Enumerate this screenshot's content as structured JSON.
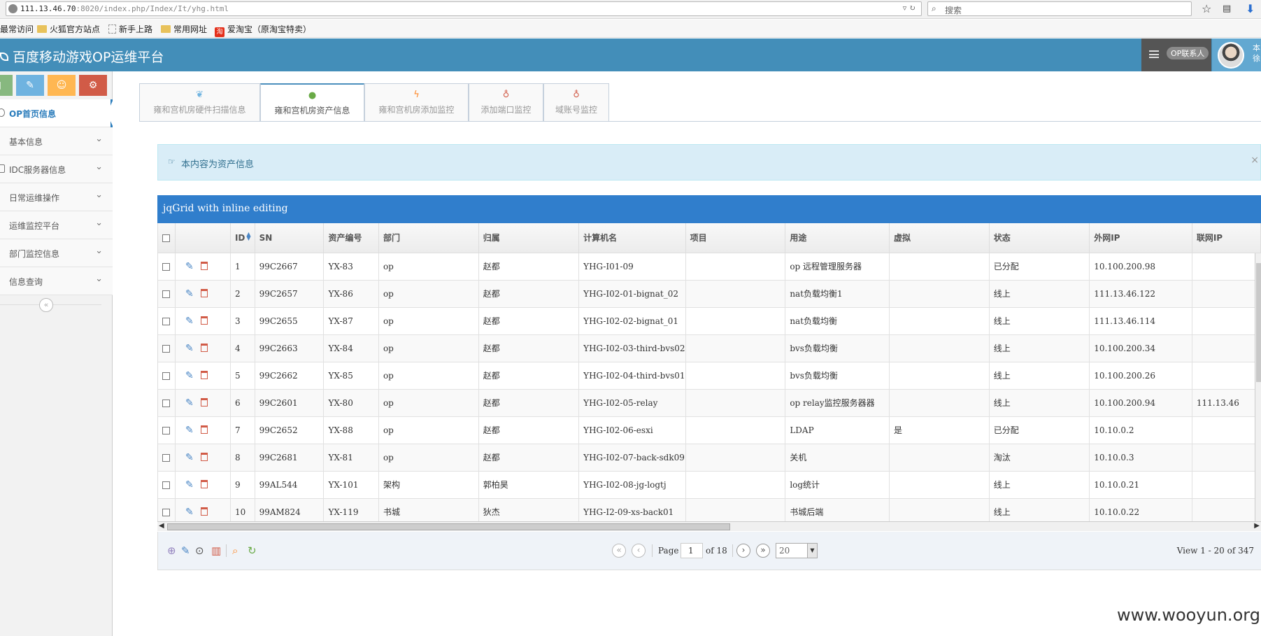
{
  "browser": {
    "url_host": "111.13.46.70",
    "url_rest": ":8020/index.php/Index/It/yhg.html",
    "search_placeholder": "搜索"
  },
  "bookmarks": [
    "最常访问",
    "火狐官方站点",
    "新手上路",
    "常用网址",
    "爱淘宝（原淘宝特卖）"
  ],
  "header": {
    "title": "百度移动游戏OP运维平台",
    "contact_badge": "OP联系人",
    "user_name": "本 徐"
  },
  "sidebar": {
    "shortcut_colors": [
      "#87b87f",
      "#6fb3e0",
      "#ffb752",
      "#d15b47"
    ],
    "shortcut_icons": [
      "chart-icon",
      "pencil-icon",
      "users-icon",
      "cogs-icon"
    ],
    "items": [
      {
        "label": "OP首页信息",
        "active": true
      },
      {
        "label": "基本信息"
      },
      {
        "label": "IDC服务器信息"
      },
      {
        "label": "日常运维操作"
      },
      {
        "label": "运维监控平台"
      },
      {
        "label": "部门监控信息"
      },
      {
        "label": "信息查询"
      }
    ]
  },
  "tabs": [
    {
      "label": "雍和宫机房硬件扫描信息",
      "icon": "leaf-icon",
      "color": "#6fb3e0"
    },
    {
      "label": "雍和宫机房资产信息",
      "icon": "user-icon",
      "color": "#69aa46",
      "active": true
    },
    {
      "label": "雍和宫机房添加监控",
      "icon": "bolt-icon",
      "color": "#ff892a"
    },
    {
      "label": "添加端口监控",
      "icon": "bulb-icon",
      "color": "#d15b47"
    },
    {
      "label": "域账号监控",
      "icon": "bulb-icon",
      "color": "#d15b47"
    }
  ],
  "alert": {
    "text": "本内容为资产信息",
    "close": "×"
  },
  "grid": {
    "caption": "jqGrid with inline editing",
    "columns": [
      "ID",
      "SN",
      "资产编号",
      "部门",
      "归属",
      "计算机名",
      "项目",
      "用途",
      "虚拟",
      "状态",
      "外网IP",
      "联网IP"
    ],
    "rows": [
      [
        "1",
        "99C2667",
        "YX-83",
        "op",
        "赵都",
        "YHG-I01-09",
        "",
        "op 远程管理服务器",
        "",
        "已分配",
        "10.100.200.98",
        ""
      ],
      [
        "2",
        "99C2657",
        "YX-86",
        "op",
        "赵都",
        "YHG-I02-01-bignat_02",
        "",
        "nat负载均衡1",
        "",
        "线上",
        "111.13.46.122",
        ""
      ],
      [
        "3",
        "99C2655",
        "YX-87",
        "op",
        "赵都",
        "YHG-I02-02-bignat_01",
        "",
        "nat负载均衡",
        "",
        "线上",
        "111.13.46.114",
        ""
      ],
      [
        "4",
        "99C2663",
        "YX-84",
        "op",
        "赵都",
        "YHG-I02-03-third-bvs02",
        "",
        "bvs负载均衡",
        "",
        "线上",
        "10.100.200.34",
        ""
      ],
      [
        "5",
        "99C2662",
        "YX-85",
        "op",
        "赵都",
        "YHG-I02-04-third-bvs01",
        "",
        "bvs负载均衡",
        "",
        "线上",
        "10.100.200.26",
        ""
      ],
      [
        "6",
        "99C2601",
        "YX-80",
        "op",
        "赵都",
        "YHG-I02-05-relay",
        "",
        "op relay监控服务器器",
        "",
        "线上",
        "10.100.200.94",
        "111.13.46"
      ],
      [
        "7",
        "99C2652",
        "YX-88",
        "op",
        "赵都",
        "YHG-I02-06-esxi",
        "",
        "LDAP",
        "是",
        "已分配",
        "10.10.0.2",
        ""
      ],
      [
        "8",
        "99C2681",
        "YX-81",
        "op",
        "赵都",
        "YHG-I02-07-back-sdk09",
        "",
        "关机",
        "",
        "淘汰",
        "10.10.0.3",
        ""
      ],
      [
        "9",
        "99AL544",
        "YX-101",
        "架构",
        "郭柏昊",
        "YHG-I02-08-jg-logtj",
        "",
        "log统计",
        "",
        "线上",
        "10.10.0.21",
        ""
      ],
      [
        "10",
        "99AM824",
        "YX-119",
        "书城",
        "狄杰",
        "YHG-I2-09-xs-back01",
        "",
        "书城后端",
        "",
        "线上",
        "10.10.0.22",
        ""
      ]
    ]
  },
  "pager": {
    "page_label": "Page",
    "page_value": "1",
    "of_label": "of 18",
    "page_size": "20",
    "view_text": "View 1 - 20 of 347"
  },
  "watermark": "www.wooyun.org"
}
